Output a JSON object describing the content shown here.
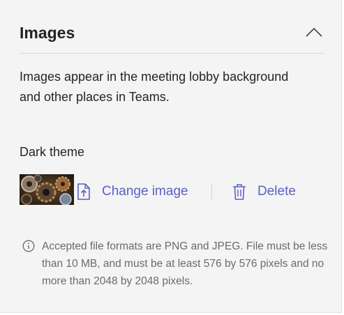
{
  "section": {
    "title": "Images",
    "description": "Images appear in the meeting lobby background and other places in Teams."
  },
  "theme": {
    "label": "Dark theme"
  },
  "actions": {
    "change_label": "Change image",
    "delete_label": "Delete"
  },
  "info": {
    "text": "Accepted file formats are PNG and JPEG. File must be less than 10 MB, and must be at least 576 by 576 pixels and no more than 2048 by 2048 pixels."
  },
  "icons": {
    "collapse": "chevron-up-icon",
    "change": "document-upload-icon",
    "delete": "trash-icon",
    "info": "info-circle-icon"
  },
  "colors": {
    "accent": "#5b5fc7",
    "panel_background": "#f4f4f4",
    "muted_text": "#6b6b6b"
  }
}
